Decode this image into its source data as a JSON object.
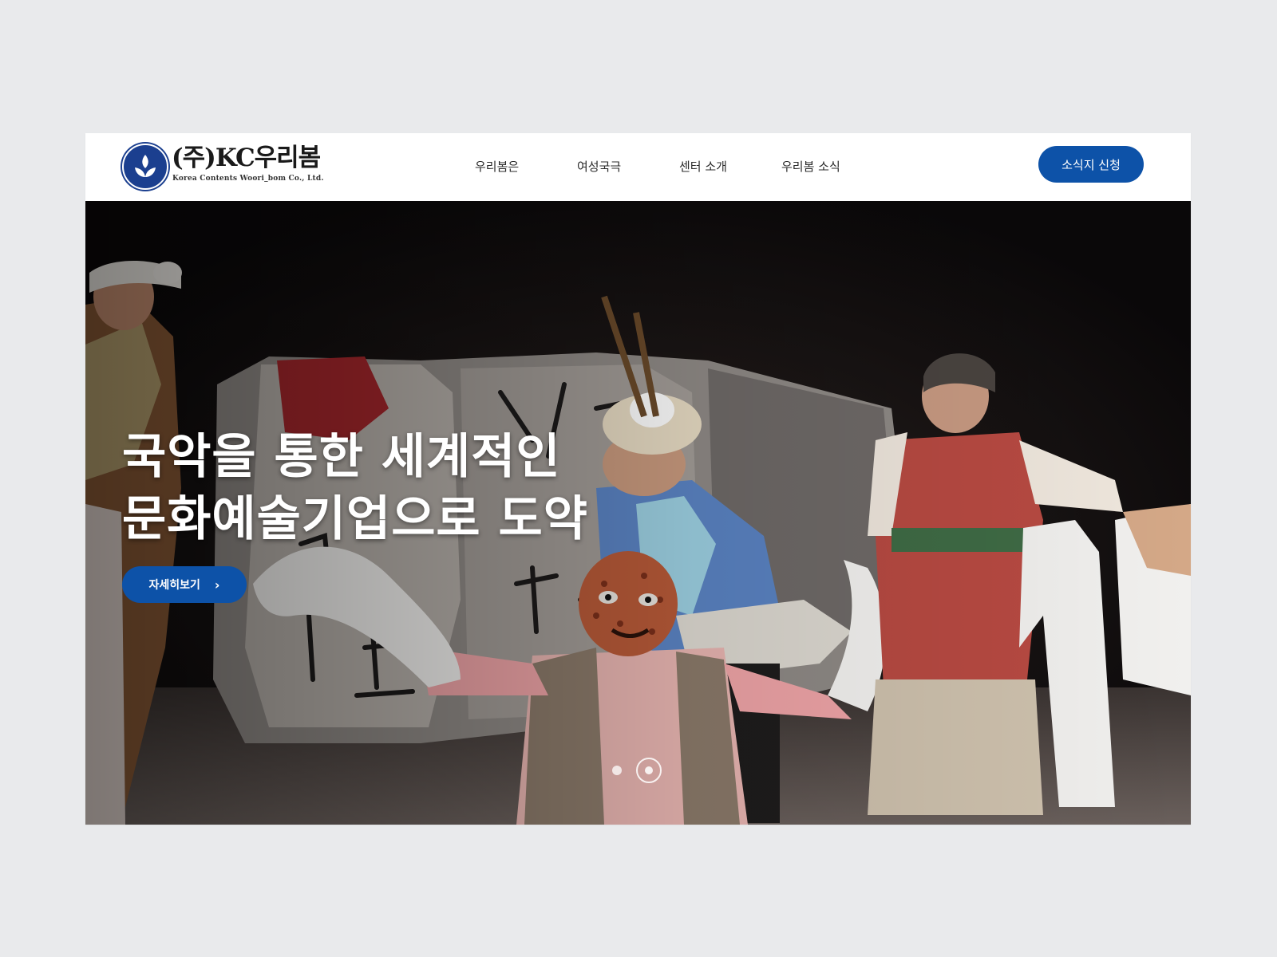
{
  "brand": {
    "name": "(주)KC우리봄",
    "subtitle": "Korea Contents Woori_bom Co., Ltd.",
    "emblem_icon": "leaf-emblem-icon",
    "color": "#1b3f8f"
  },
  "nav": {
    "items": [
      {
        "label": "우리봄은"
      },
      {
        "label": "여성국극"
      },
      {
        "label": "센터 소개"
      },
      {
        "label": "우리봄 소식"
      }
    ],
    "cta_label": "소식지 신청"
  },
  "hero": {
    "title_line1": "국악을 통한 세계적인",
    "title_line2": "문화예술기업으로 도약",
    "button_label": "자세히보기",
    "button_icon": "chevron-right-icon",
    "slides": 2,
    "active_slide": 2
  },
  "colors": {
    "accent": "#0d52a8",
    "page_background": "#e9eaec"
  }
}
